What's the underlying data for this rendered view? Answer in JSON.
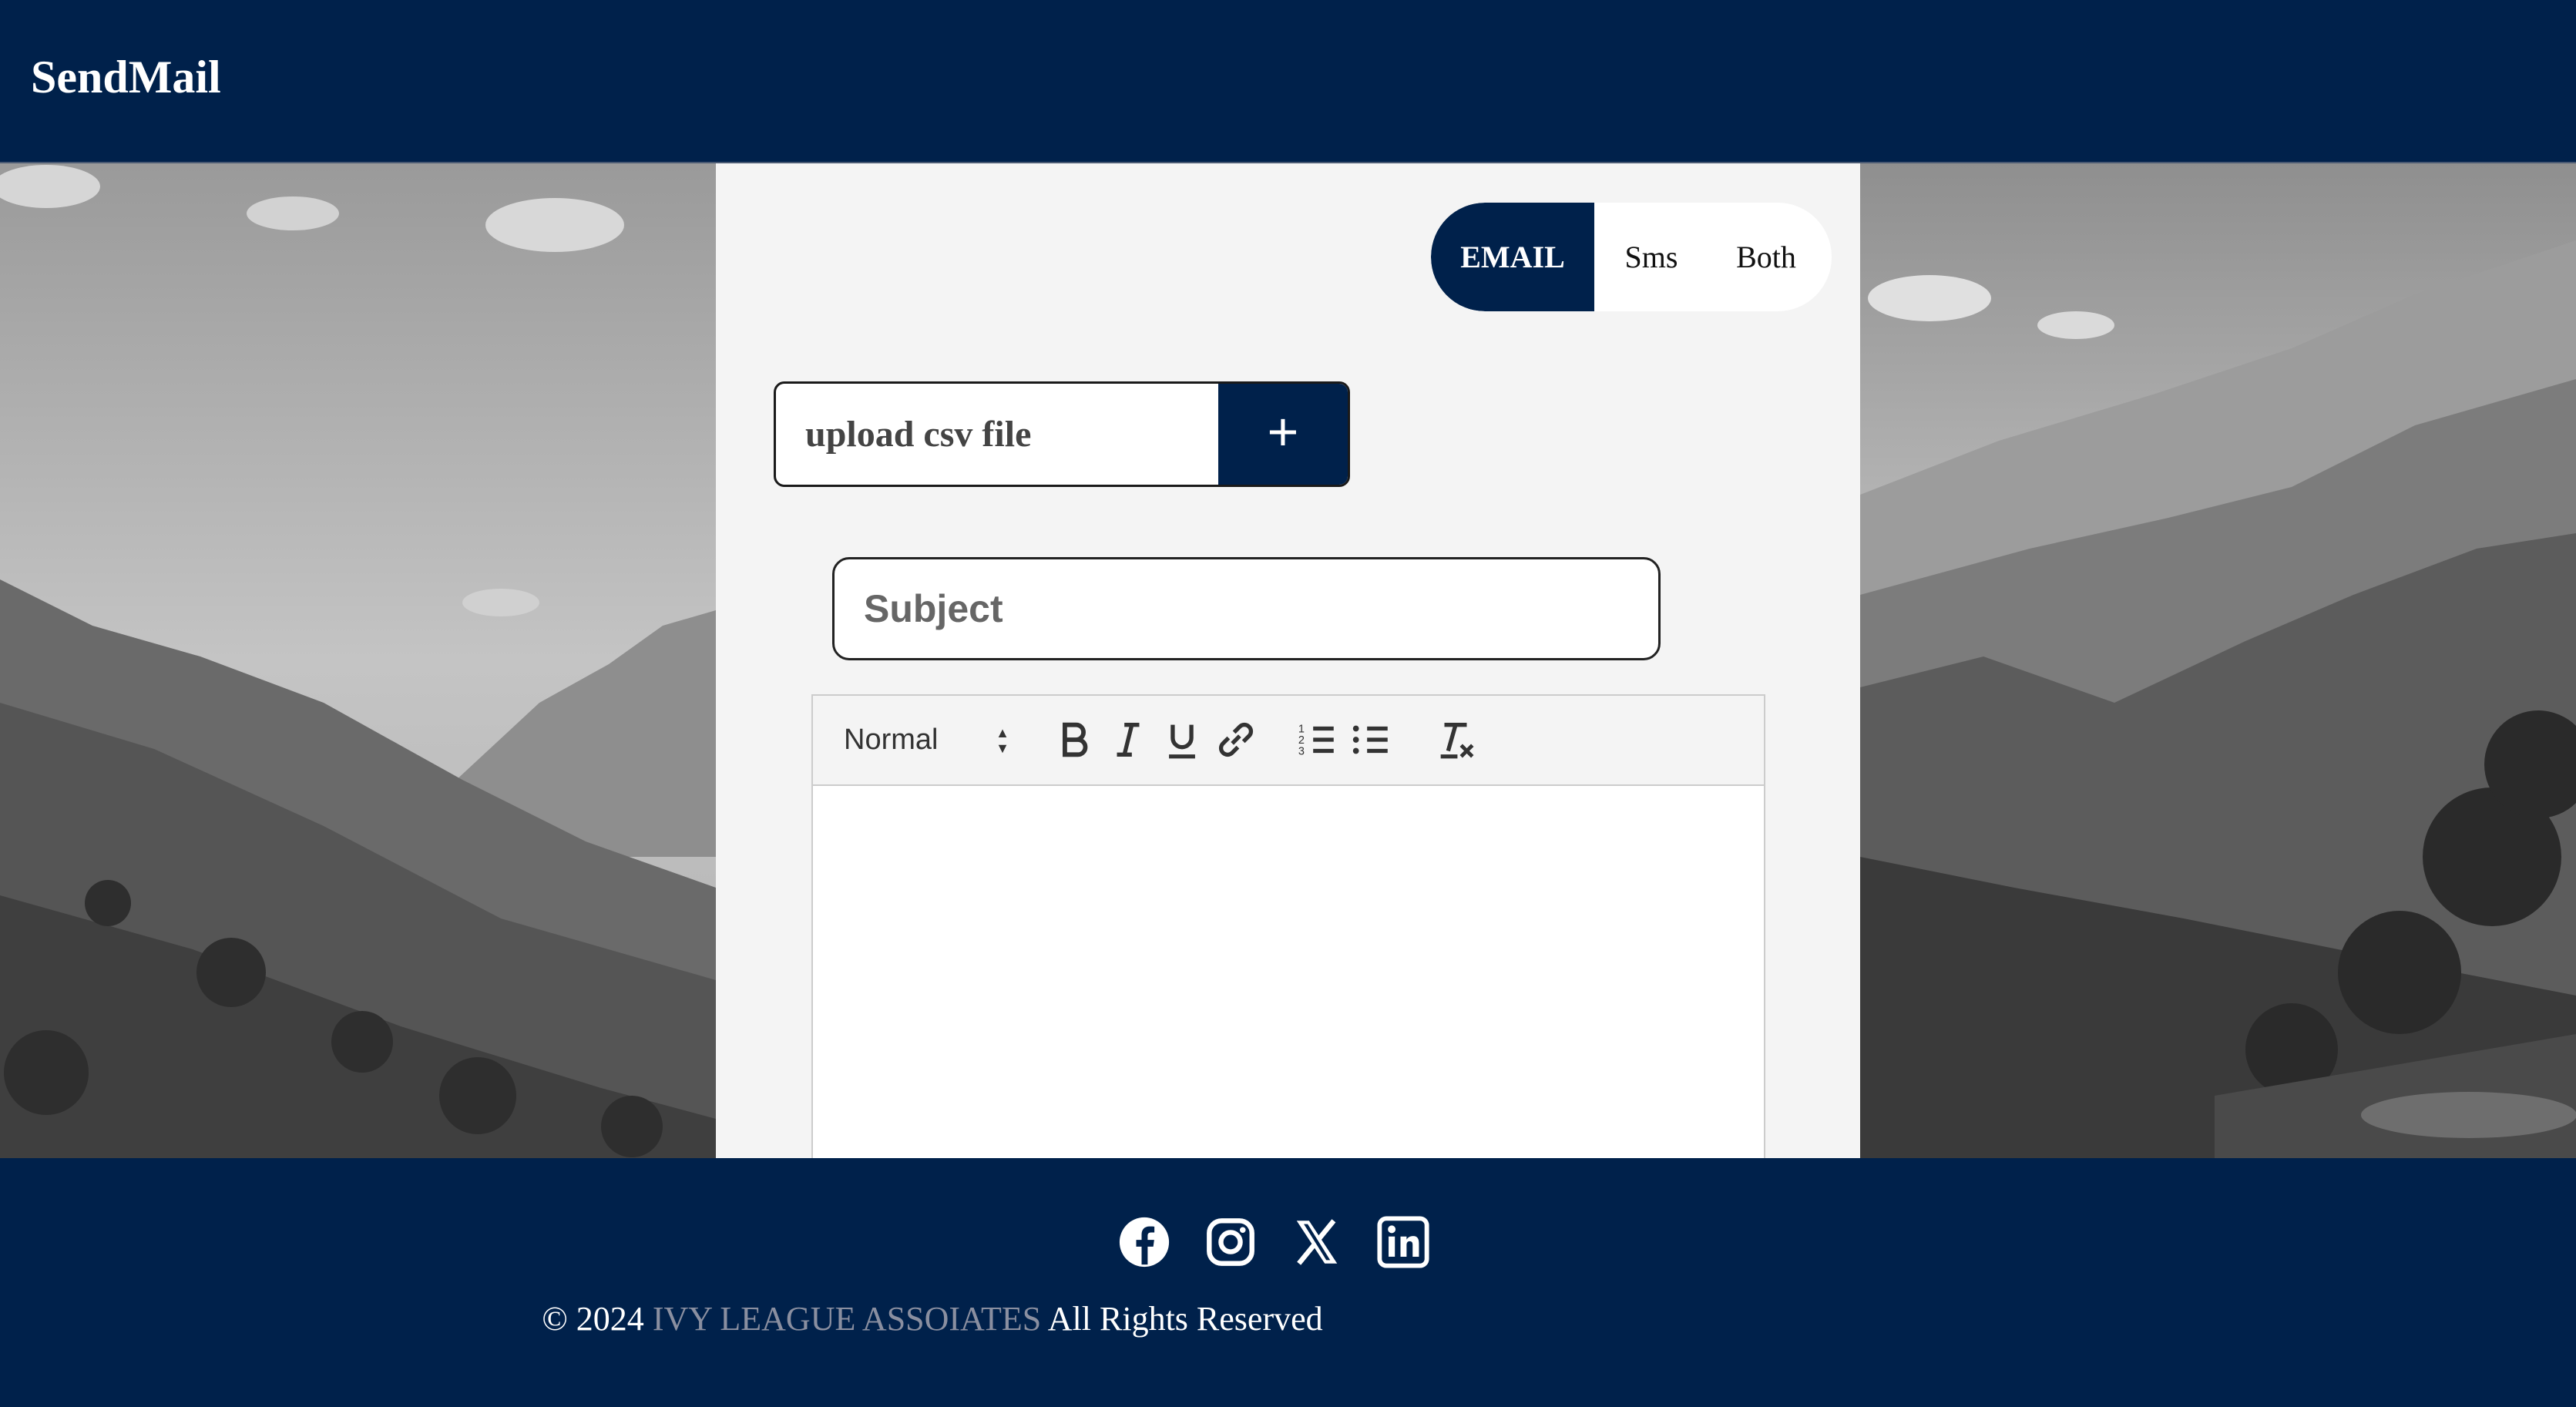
{
  "navbar": {
    "brand": "SendMail"
  },
  "mode_toggle": {
    "options": [
      "EMAIL",
      "Sms",
      "Both"
    ],
    "selected": "EMAIL"
  },
  "upload": {
    "label": "upload csv file",
    "button_icon": "plus-icon",
    "button_glyph": "+"
  },
  "subject": {
    "placeholder": "Subject",
    "value": ""
  },
  "editor": {
    "format_select": "Normal",
    "toolbar_icons": [
      "bold-icon",
      "italic-icon",
      "underline-icon",
      "link-icon",
      "ordered-list-icon",
      "bullet-list-icon",
      "clear-format-icon"
    ],
    "body_text": ""
  },
  "footer": {
    "social_icons": [
      "facebook-icon",
      "instagram-icon",
      "x-icon",
      "linkedin-icon"
    ],
    "copyright_prefix": "© 2024",
    "company": "IVY LEAGUE ASSOIATES",
    "copyright_suffix": "All Rights Reserved"
  },
  "colors": {
    "navy": "#00214b",
    "panel": "#f4f4f4",
    "company_text": "#8a8fa0"
  }
}
